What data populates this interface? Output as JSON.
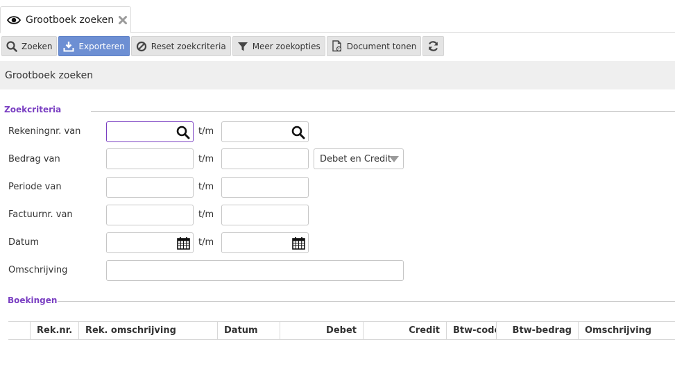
{
  "tab": {
    "label": "Grootboek zoeken"
  },
  "toolbar": {
    "search": "Zoeken",
    "export": "Exporteren",
    "reset": "Reset zoekcriteria",
    "more": "Meer zoekopties",
    "document": "Document tonen",
    "accent_color": "#6d8fd3"
  },
  "page": {
    "title": "Grootboek zoeken"
  },
  "criteria": {
    "legend": "Zoekcriteria",
    "tm": "t/m",
    "account_from": {
      "label": "Rekeningnr. van",
      "value": "",
      "value_to": ""
    },
    "amount_from": {
      "label": "Bedrag van",
      "value": "",
      "value_to": "",
      "type_select": "Debet en Credit"
    },
    "period_from": {
      "label": "Periode van",
      "value": "",
      "value_to": ""
    },
    "invoice_from": {
      "label": "Factuurnr. van",
      "value": "",
      "value_to": ""
    },
    "date": {
      "label": "Datum",
      "value": "",
      "value_to": ""
    },
    "description": {
      "label": "Omschrijving",
      "value": ""
    }
  },
  "bookings": {
    "legend": "Boekingen",
    "columns": [
      "Rek.nr.",
      "Rek. omschrijving",
      "Datum",
      "Debet",
      "Credit",
      "Btw-code",
      "Btw-bedrag",
      "Omschrijving"
    ]
  },
  "colors": {
    "legend": "#7a3fc2",
    "focus_border": "#7a3fc2",
    "header_bg": "#efefef"
  },
  "icons": [
    "eye-icon",
    "close-icon",
    "search-icon",
    "download-icon",
    "ban-icon",
    "filter-icon",
    "document-icon",
    "refresh-icon",
    "calendar-icon",
    "caret-down-icon"
  ]
}
